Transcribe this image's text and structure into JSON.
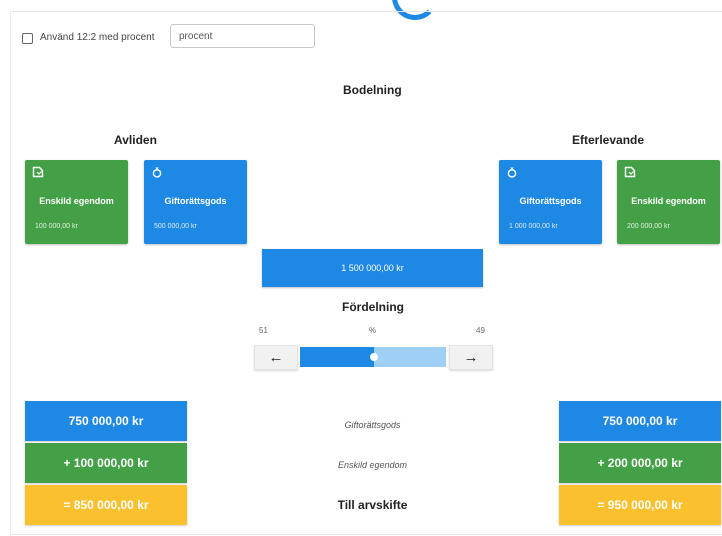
{
  "options": {
    "checkbox_label": "Använd 12:2 med procent",
    "checked": false,
    "percent_input": {
      "value": "",
      "placeholder": "procent"
    }
  },
  "title": "Bodelning",
  "left": {
    "heading": "Avliden",
    "cards": [
      {
        "icon": "tag-icon",
        "label": "Enskild egendom",
        "amount": "100 000,00 kr",
        "color": "#43a047"
      },
      {
        "icon": "ring-icon",
        "label": "Giftorättsgods",
        "amount": "500 000,00 kr",
        "color": "#1e88e5"
      }
    ]
  },
  "right": {
    "heading": "Efterlevande",
    "cards": [
      {
        "icon": "ring-icon",
        "label": "Giftorättsgods",
        "amount": "1 000 000,00 kr",
        "color": "#1e88e5"
      },
      {
        "icon": "tag-icon",
        "label": "Enskild egendom",
        "amount": "200 000,00 kr",
        "color": "#43a047"
      }
    ]
  },
  "total": "1 500 000,00 kr",
  "distribution": {
    "heading": "Fördelning",
    "left_value": "51",
    "unit": "%",
    "right_value": "49",
    "slider_fraction": 0.51,
    "left_button_icon": "arrow-left-icon",
    "right_button_icon": "arrow-right-icon"
  },
  "results": {
    "rows": [
      {
        "label": "Giftorättsgods",
        "left": "750 000,00 kr",
        "right": "750 000,00 kr",
        "color": "#1e88e5"
      },
      {
        "label": "Enskild egendom",
        "left": "+ 100 000,00 kr",
        "right": "+ 200 000,00 kr",
        "color": "#43a047"
      },
      {
        "label": "Till arvskifte",
        "left": "= 850 000,00 kr",
        "right": "= 950 000,00 kr",
        "color": "#fbc02d"
      }
    ]
  },
  "colors": {
    "blue": "#1e88e5",
    "green": "#43a047",
    "yellow": "#fbc02d",
    "light_blue": "#9ecff5"
  }
}
